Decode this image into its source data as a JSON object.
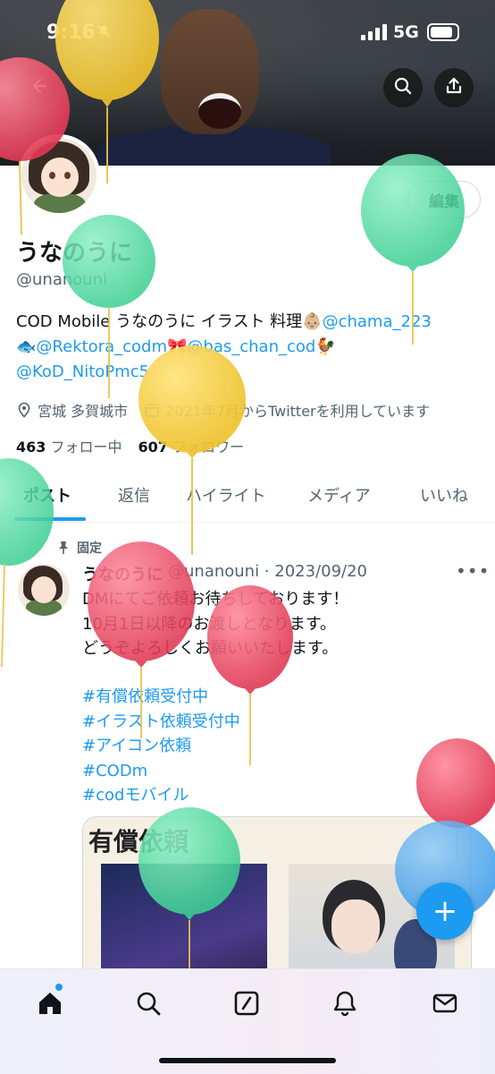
{
  "status_bar": {
    "time": "9:16",
    "network": "5G"
  },
  "profile": {
    "name": "うなのうに",
    "handle": "@unanouni",
    "edit_label": "編集",
    "bio": {
      "line1_text": "COD Mobile うなのうに イラスト 料理👶🏼",
      "mention1": "@chama_223",
      "emoji2": "🐟",
      "mention2": "@Rektora_codm",
      "emoji3": "🎀",
      "mention3": "@bas_chan_cod",
      "emoji4": "🐓",
      "mention4": "@KoD_NitoPmc5"
    },
    "location": "宮城 多賀城市",
    "joined": "2021年7月からTwitterを利用しています",
    "following_count": "463",
    "following_label": "フォロー中",
    "followers_count": "607",
    "followers_label": "フォロワー"
  },
  "tabs": [
    "ポスト",
    "返信",
    "ハイライト",
    "メディア",
    "いいね"
  ],
  "post": {
    "pinned_label": "固定",
    "author": "うなのうに",
    "meta": "@unanouni · 2023/09/20",
    "body": [
      "DMにてご依頼お待ちしております！",
      "10月1日以降のお渡しとなります。",
      "どうぞよろしくお願いいたします。"
    ],
    "hashtags": [
      "#有償依頼受付中",
      "#イラスト依頼受付中",
      "#アイコン依頼",
      "#CODm",
      "#codモバイル"
    ],
    "card_title": "有償依頼"
  },
  "fab_label": "+",
  "colors": {
    "accent": "#1d9bf0",
    "text": "#0f1419",
    "muted": "#536471",
    "balloon_red": "#e8435e",
    "balloon_yellow": "#f3cd3c",
    "balloon_green": "#4fd9a0",
    "balloon_blue": "#4aa8ee"
  },
  "icons": {
    "back": "arrow-left-icon",
    "search": "search-icon",
    "share": "share-icon",
    "home": "home-icon",
    "compose": "compose-icon",
    "notifications": "bell-icon",
    "messages": "mail-icon"
  }
}
